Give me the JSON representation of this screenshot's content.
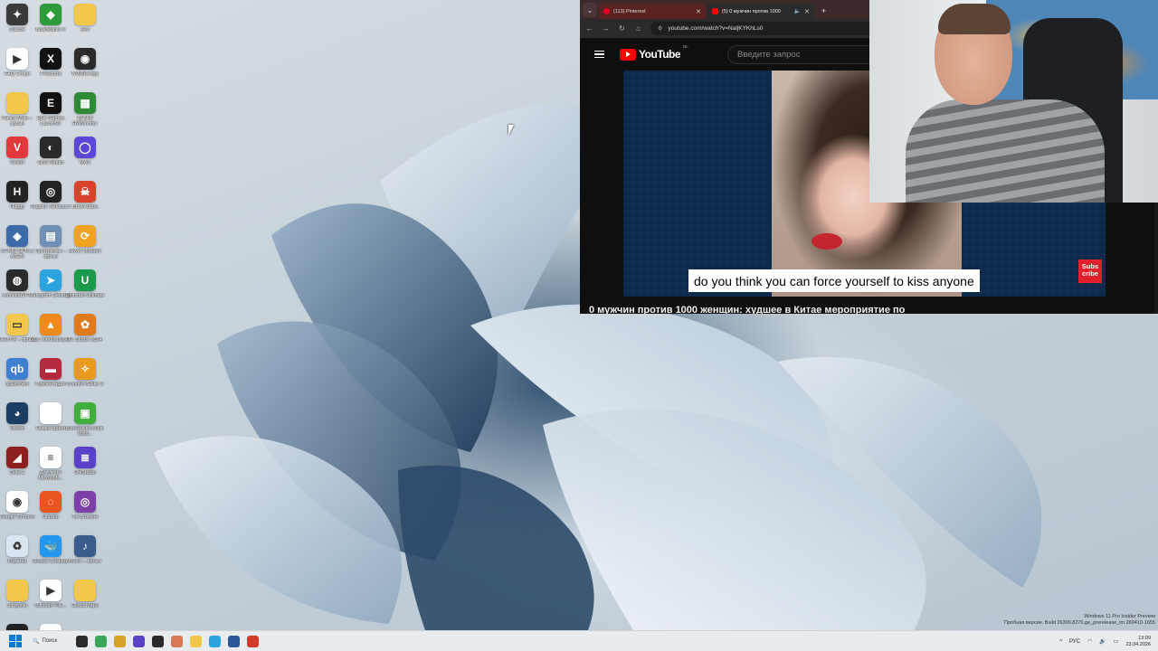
{
  "desktop": {
    "icons": [
      {
        "label": "Claude",
        "icon": "claude-icon",
        "color": "#3a3a3a",
        "glyph": "✦"
      },
      {
        "label": "BlueStacks X",
        "icon": "bluestacks-icon",
        "color": "#2e9b3a",
        "glyph": "◆"
      },
      {
        "label": "Ани",
        "icon": "folder-icon",
        "color": "#f1c84b",
        "glyph": ""
      },
      {
        "label": "FAQ Стори",
        "icon": "media-file-icon",
        "color": "#ffffff",
        "glyph": "▶"
      },
      {
        "label": "FXSound",
        "icon": "fxsound-icon",
        "color": "#111111",
        "glyph": "X"
      },
      {
        "label": "NVIDIA App",
        "icon": "nvidia-icon",
        "color": "#2b2b2b",
        "glyph": "◉"
      },
      {
        "label": "Папка Main – ярлык",
        "icon": "folder-shortcut-icon",
        "color": "#f1c84b",
        "glyph": ""
      },
      {
        "label": "Epic Games Launcher",
        "icon": "epic-games-icon",
        "color": "#111111",
        "glyph": "E"
      },
      {
        "label": "CPUID HWMonitor",
        "icon": "hwmonitor-icon",
        "color": "#2f8a35",
        "glyph": "▦"
      },
      {
        "label": "Vivaldi",
        "icon": "vivaldi-icon",
        "color": "#e2393c",
        "glyph": "V"
      },
      {
        "label": "OBS Studio",
        "icon": "obs-icon",
        "color": "#2a2a2a",
        "glyph": "◐"
      },
      {
        "label": "MAX",
        "icon": "max-messenger-icon",
        "color": "#5a47d8",
        "glyph": "◯"
      },
      {
        "label": "Haggy",
        "icon": "haggy-icon",
        "color": "#222222",
        "glyph": "H"
      },
      {
        "label": "Яндекс Телемост",
        "icon": "telemost-icon",
        "color": "#222222",
        "glyph": "◎"
      },
      {
        "label": "Brawl Stars",
        "icon": "brawl-stars-icon",
        "color": "#d9432b",
        "glyph": "☠"
      },
      {
        "label": "CPUID GPU-Z ASUS",
        "icon": "gpuz-icon",
        "color": "#3d6aa8",
        "glyph": "◈"
      },
      {
        "label": "Программы – ярлык",
        "icon": "programs-shortcut-icon",
        "color": "#6f8fb5",
        "glyph": "▤"
      },
      {
        "label": "Driver Updater",
        "icon": "driver-updater-icon",
        "color": "#f0a323",
        "glyph": "⟳"
      },
      {
        "label": "AmneziaVPN",
        "icon": "amneziavpn-icon",
        "color": "#2b2b2b",
        "glyph": "◍"
      },
      {
        "label": "Telegram Desktop",
        "icon": "telegram-icon",
        "color": "#2aa3df",
        "glyph": "➤"
      },
      {
        "label": "Uninstall Ultimate",
        "icon": "uninstall-icon",
        "color": "#1a9a4a",
        "glyph": "U"
      },
      {
        "label": "Мой ПК – ярлык",
        "icon": "my-pc-shortcut-icon",
        "color": "#f1c84b",
        "glyph": "▭"
      },
      {
        "label": "VLC media player",
        "icon": "vlc-icon",
        "color": "#f08a1c",
        "glyph": "▲"
      },
      {
        "label": "FL Studio 2024",
        "icon": "fl-studio-icon",
        "color": "#e07a1f",
        "glyph": "✿"
      },
      {
        "label": "qBittorrent",
        "icon": "qbittorrent-icon",
        "color": "#3d7fd1",
        "glyph": "qb"
      },
      {
        "label": "Презентация",
        "icon": "presentation-icon",
        "color": "#b52a3c",
        "glyph": "▬"
      },
      {
        "label": "Counter-Strike 2",
        "icon": "cs2-icon",
        "color": "#e89a1c",
        "glyph": "✧"
      },
      {
        "label": "Steam",
        "icon": "steam-icon",
        "color": "#1b3d63",
        "glyph": "◕"
      },
      {
        "label": "Новый файл",
        "icon": "blank-file-icon",
        "color": "#ffffff",
        "glyph": ""
      },
      {
        "label": "BlueStacks Multi-Insta...",
        "icon": "bluestacks-multi-icon",
        "color": "#3fae3a",
        "glyph": "▣"
      },
      {
        "label": "Dota 2",
        "icon": "dota2-icon",
        "color": "#8e1f1f",
        "glyph": "◢"
      },
      {
        "label": "Документ Microsoft...",
        "icon": "word-document-icon",
        "color": "#ffffff",
        "glyph": "≡"
      },
      {
        "label": "UniStudio",
        "icon": "unistudio-icon",
        "color": "#5a42c8",
        "glyph": "≣"
      },
      {
        "label": "Google Chrome",
        "icon": "chrome-icon",
        "color": "#ffffff",
        "glyph": "◉"
      },
      {
        "label": "Ubuntu",
        "icon": "ubuntu-icon",
        "color": "#e95420",
        "glyph": "◌"
      },
      {
        "label": "Tor Browser",
        "icon": "tor-browser-icon",
        "color": "#7d3fa8",
        "glyph": "◎"
      },
      {
        "label": "Корзина",
        "icon": "recycle-bin-icon",
        "color": "#d9e6f2",
        "glyph": "♻"
      },
      {
        "label": "Docker Desktop",
        "icon": "docker-icon",
        "color": "#2396ed",
        "glyph": "🐳"
      },
      {
        "label": "Music – ярлык",
        "icon": "music-shortcut-icon",
        "color": "#3b5b8c",
        "glyph": "♪"
      },
      {
        "label": "Загрузки",
        "icon": "downloads-folder-icon",
        "color": "#f1c84b",
        "glyph": ""
      },
      {
        "label": "Ultimate File...",
        "icon": "media-file-2-icon",
        "color": "#ffffff",
        "glyph": "▶"
      },
      {
        "label": "Cloud Mapo",
        "icon": "folder-cloud-icon",
        "color": "#f1c84b",
        "glyph": ""
      },
      {
        "label": "Яндекс Телемост",
        "icon": "telemost-2-icon",
        "color": "#222222",
        "glyph": "◎"
      },
      {
        "label": "Видео 2026",
        "icon": "video-file-icon",
        "color": "#ffffff",
        "glyph": "▶"
      }
    ]
  },
  "browser": {
    "tabs": [
      {
        "title": "(113) Pinterest",
        "favicon": "pinterest-icon",
        "active": false
      },
      {
        "title": "(5) 0 мужчин против 1000",
        "favicon": "youtube-favicon-icon",
        "active": true
      }
    ],
    "new_tab": "+",
    "menu_glyph": "⌄",
    "url": "youtube.com/watch?v=NaljKYKhLs0",
    "nav": {
      "back": "←",
      "forward": "→",
      "reload": "↻",
      "home": "⌂",
      "site_info": "⚙"
    },
    "youtube": {
      "logo_text": "YouTube",
      "country_code": "NL",
      "search_placeholder": "Введите запрос",
      "caption": "do you think you can force yourself to kiss anyone",
      "subscribe_badge": "Subs cribe",
      "video_title": "0 мужчин против 1000 женщин: худшее в Китае мероприятие по"
    }
  },
  "watermark": {
    "line1": "Windows 11 Pro Insider Preview",
    "line2": "Пробная версия. Build 26300.8276.ge_prerelease_im.260410-1655"
  },
  "taskbar": {
    "search_label": "Поиск",
    "apps": [
      {
        "name": "task-view-icon",
        "color": "#2b2b2b"
      },
      {
        "name": "chrome-taskbar-icon",
        "color": "#3aa757"
      },
      {
        "name": "chrome-dev-taskbar-icon",
        "color": "#d8a227"
      },
      {
        "name": "unistudio-taskbar-icon",
        "color": "#5a42c8"
      },
      {
        "name": "obs-taskbar-icon",
        "color": "#2a2a2a"
      },
      {
        "name": "claude-taskbar-icon",
        "color": "#d97757"
      },
      {
        "name": "file-explorer-taskbar-icon",
        "color": "#f1c84b"
      },
      {
        "name": "telegram-taskbar-icon",
        "color": "#2aa3df"
      },
      {
        "name": "word-taskbar-icon",
        "color": "#2b579a"
      },
      {
        "name": "chrome-profile-taskbar-icon",
        "color": "#d33a2c"
      }
    ],
    "lang": "РУС",
    "time": "13:09",
    "date": "23.04.2026",
    "tray_chevron": "^"
  }
}
